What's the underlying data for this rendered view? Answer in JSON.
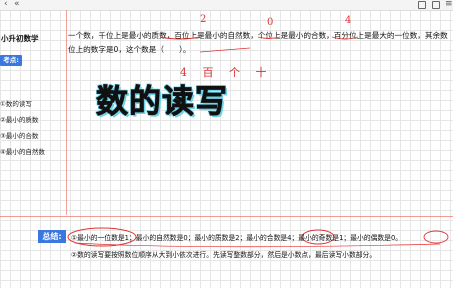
{
  "toolbar": {
    "back_glyph": "‹",
    "collapse_glyph": "«",
    "separator": "≡"
  },
  "sidebar": {
    "title": "小升初数学",
    "badge": "考点:",
    "items": [
      {
        "label": "①数的读写"
      },
      {
        "label": "②最小的质数"
      },
      {
        "label": "③最小的合数"
      },
      {
        "label": "④最小的自然数"
      }
    ]
  },
  "question": {
    "text": "一个数，千位上是最小的质数，百位上是最小的自然数，个位上是最小的合数，百分位上是最大的一位数，其余数位上的数字是0，这个数是（　　）。"
  },
  "main": {
    "title": "数的读写"
  },
  "annotations": {
    "digits": [
      "2",
      "0",
      "4"
    ],
    "handwriting": "4 百 个 十"
  },
  "summary": {
    "badge": "总结:",
    "line1": "①最小的一位数是1；最小的自然数是0；最小的质数是2；最小的合数是4；最小的奇数是1；最小的偶数是0。",
    "line2": "②数的读写要按照数位顺序从大到小依次进行。先读写整数部分，然后是小数点，最后读写小数部分。"
  },
  "colors": {
    "accent": "#3a78e0",
    "ink_red": "#e03232",
    "grid": "#e6e6e6"
  }
}
